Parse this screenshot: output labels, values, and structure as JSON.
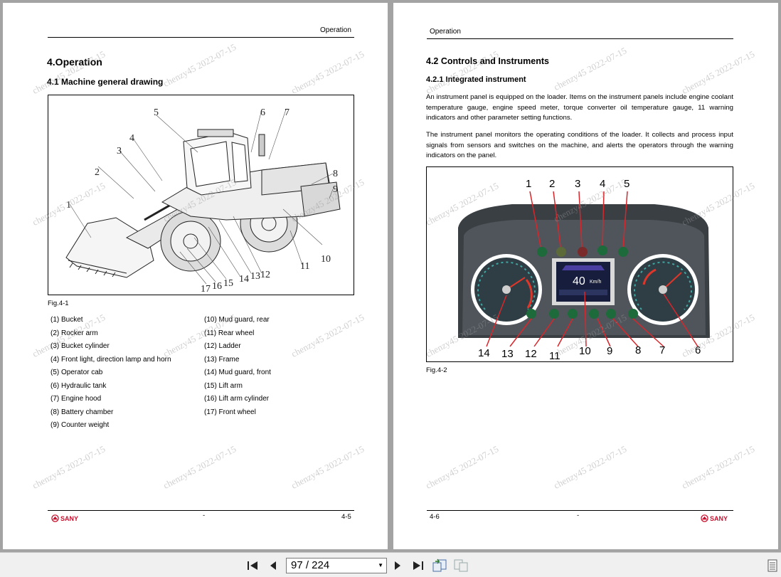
{
  "left_page": {
    "header": "Operation",
    "chapter_title": "4.Operation",
    "section_title": "4.1 Machine general drawing",
    "figure_caption": "Fig.4-1",
    "figure_callouts": [
      "1",
      "2",
      "3",
      "4",
      "5",
      "6",
      "7",
      "8",
      "9",
      "10",
      "11",
      "12",
      "13",
      "14",
      "15",
      "16",
      "17"
    ],
    "parts_col1": [
      "(1) Bucket",
      "(2) Rocker arm",
      "(3) Bucket cylinder",
      "(4) Front light, direction lamp and horn",
      "(5) Operator cab",
      "(6) Hydraulic tank",
      "(7) Engine hood",
      "(8) Battery chamber",
      "(9) Counter weight"
    ],
    "parts_col2": [
      "(10) Mud guard, rear",
      "(11) Rear wheel",
      "(12) Ladder",
      "(13) Frame",
      "(14) Mud guard, front",
      "(15) Lift arm",
      "(16) Lift arm cylinder",
      "(17) Front wheel"
    ],
    "footer_center": "-",
    "footer_page": "4-5",
    "logo": "SANY"
  },
  "right_page": {
    "header": "Operation",
    "section_title": "4.2 Controls and Instruments",
    "subsection_title": "4.2.1 Integrated instrument",
    "paragraph1": "An instrument panel is equipped on the loader. Items on the instrument panels include engine coolant temperature gauge, engine speed meter, torque converter oil temperature gauge, 11 warning indicators and other parameter setting functions.",
    "paragraph2": "The instrument panel monitors the operating conditions of the loader. It collects and process input signals from sensors and switches on the machine, and alerts the operators through the warning indicators on the panel.",
    "figure_caption": "Fig.4-2",
    "instrument_callouts_top": [
      "1",
      "2",
      "3",
      "4",
      "5"
    ],
    "instrument_callouts_bottom": [
      "14",
      "13",
      "12",
      "11",
      "10",
      "9",
      "8",
      "7",
      "6"
    ],
    "display_speed": "40",
    "display_unit": "Km/h",
    "footer_page": "4-6",
    "footer_center": "-",
    "logo": "SANY"
  },
  "watermark": "chenzy45 2022-07-15",
  "toolbar": {
    "page_display": "97 / 224"
  },
  "colors": {
    "brand_red": "#c8102e",
    "callout_red": "#d8262b"
  }
}
